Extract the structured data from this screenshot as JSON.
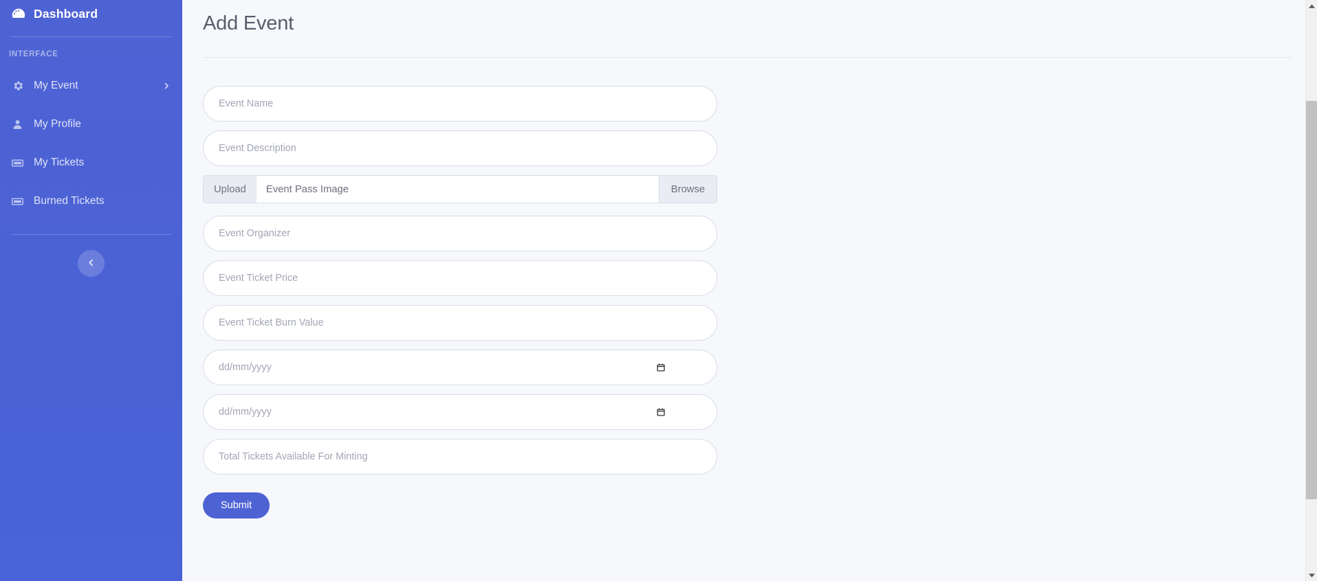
{
  "sidebar": {
    "brand": {
      "label": "Dashboard",
      "icon": "tachometer-icon"
    },
    "heading": "INTERFACE",
    "items": [
      {
        "label": "My Event",
        "icon": "gear-icon",
        "chevron": "chevron-right-icon"
      },
      {
        "label": "My Profile",
        "icon": "user-icon"
      },
      {
        "label": "My Tickets",
        "icon": "ticket-icon"
      },
      {
        "label": "Burned Tickets",
        "icon": "ticket-icon"
      }
    ],
    "collapse": {
      "icon": "chevron-left-icon",
      "label": "Collapse sidebar"
    },
    "background_color": "#4e63d3"
  },
  "main": {
    "page_title": "Add Event",
    "form": {
      "event_name": {
        "placeholder": "Event Name",
        "value": ""
      },
      "event_description": {
        "placeholder": "Event Description",
        "value": ""
      },
      "upload": {
        "label": "Upload",
        "placeholder": "Event Pass Image",
        "value": "",
        "browse_label": "Browse"
      },
      "event_organizer": {
        "placeholder": "Event Organizer",
        "value": ""
      },
      "event_ticket_price": {
        "placeholder": "Event Ticket Price",
        "value": ""
      },
      "event_ticket_burn_value": {
        "placeholder": "Event Ticket Burn Value",
        "value": ""
      },
      "event_start_date": {
        "placeholder": "dd/mm/yyyy",
        "value": "",
        "icon": "calendar-icon"
      },
      "event_end_date": {
        "placeholder": "dd/mm/yyyy",
        "value": "",
        "icon": "calendar-icon"
      },
      "total_tickets": {
        "placeholder": "Total Tickets Available For Minting",
        "value": ""
      },
      "submit_label": "Submit"
    },
    "background_color": "#f6f8fc",
    "accent_color": "#4e63d3"
  },
  "scrollbar": {
    "up_icon": "triangle-up-icon",
    "down_icon": "triangle-down-icon"
  }
}
